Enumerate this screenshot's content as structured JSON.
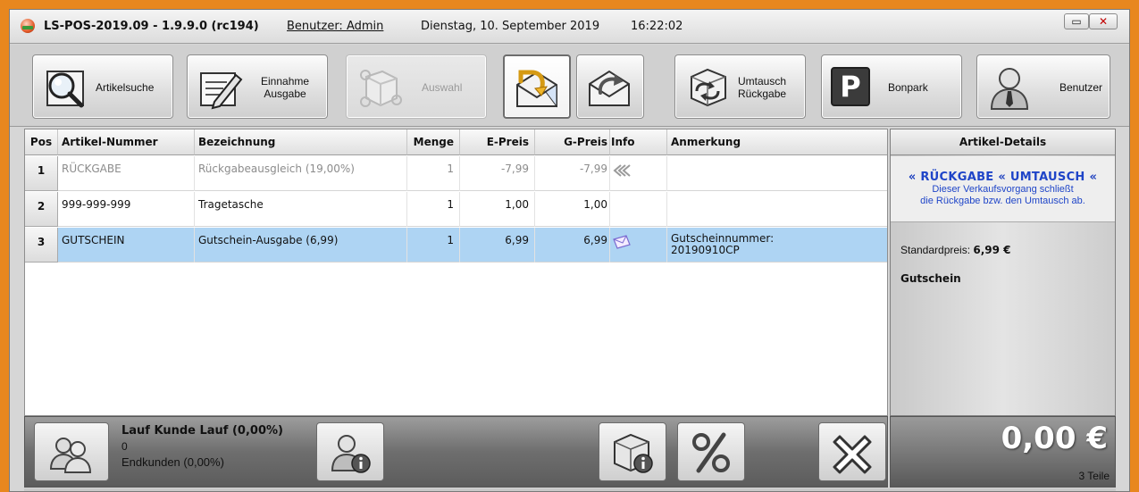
{
  "window": {
    "title": "LS-POS-2019.09 - 1.9.9.0 (rc194)",
    "user": "Benutzer: Admin",
    "date": "Dienstag, 10. September 2019",
    "time": "16:22:02",
    "minimize_label": "▭",
    "close_label": "✕"
  },
  "toolbar": {
    "search": "Artikelsuche",
    "income_1": "Einnahme",
    "income_2": "Ausgabe",
    "selection": "Auswahl",
    "exchange_1": "Umtausch",
    "exchange_2": "Rückgabe",
    "park_icon_letter": "P",
    "park": "Bonpark",
    "user": "Benutzer"
  },
  "table": {
    "headers": {
      "pos": "Pos",
      "article_no": "Artikel-Nummer",
      "description": "Bezeichnung",
      "qty": "Menge",
      "unit_price": "E-Preis",
      "total_price": "G-Preis",
      "info": "Info",
      "note": "Anmerkung"
    },
    "rows": [
      {
        "pos": "1",
        "article_no": "RÜCKGABE",
        "description": "Rückgabeausgleich (19,00%)",
        "qty": "1",
        "unit_price": "-7,99",
        "total_price": "-7,99",
        "info": "return-chevron-icon",
        "note_1": "",
        "note_2": ""
      },
      {
        "pos": "2",
        "article_no": "999-999-999",
        "description": "Tragetasche",
        "qty": "1",
        "unit_price": "1,00",
        "total_price": "1,00",
        "info": "",
        "note_1": "",
        "note_2": ""
      },
      {
        "pos": "3",
        "article_no": "GUTSCHEIN",
        "description": "Gutschein-Ausgabe (6,99)",
        "qty": "1",
        "unit_price": "6,99",
        "total_price": "6,99",
        "info": "voucher-envelope-icon",
        "note_1": "Gutscheinnummer:",
        "note_2": "20190910CP"
      }
    ]
  },
  "details": {
    "header": "Artikel-Details",
    "chevrons": "«",
    "return_label": "RÜCKGABE",
    "exchange_label": "UMTAUSCH",
    "note_line1": "Dieser Verkaufsvorgang schließt",
    "note_line2": "die Rückgabe bzw. den Umtausch ab.",
    "std_price_label": "Standardpreis:",
    "std_price_value": "6,99 €",
    "article_name": "Gutschein"
  },
  "customer": {
    "name": "Lauf Kunde Lauf (0,00%)",
    "number": "0",
    "type": "Endkunden (0,00%)"
  },
  "totals": {
    "amount": "0,00 €",
    "items_count": "3 Teile"
  },
  "colors": {
    "frame": "#e8871e",
    "selected_row": "#aed4f3",
    "accent_blue": "#1f45c8"
  }
}
